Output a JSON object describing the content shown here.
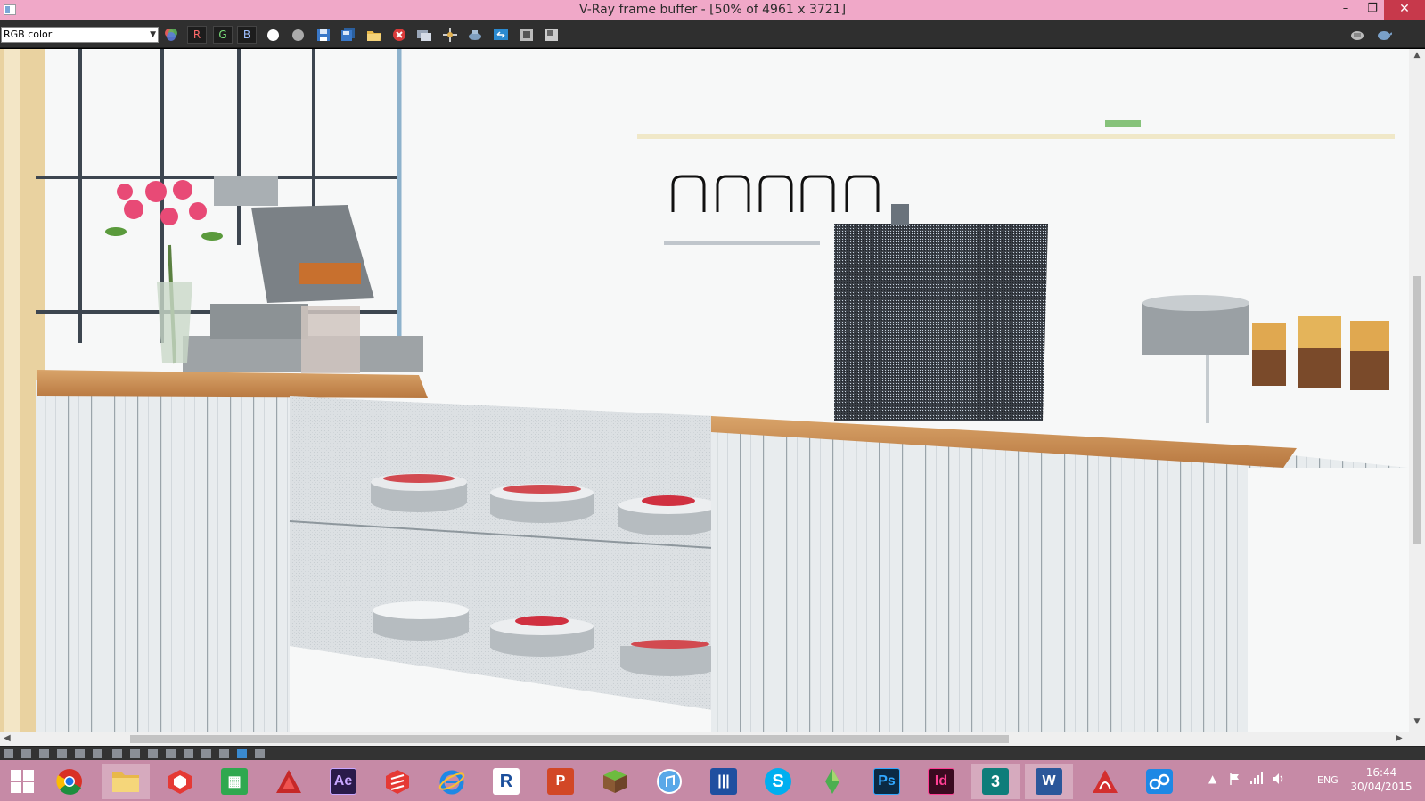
{
  "window": {
    "title": "V-Ray frame buffer - [50% of 4961 x 3721]",
    "minimize_glyph": "–",
    "maximize_glyph": "❐",
    "close_glyph": "✕"
  },
  "toolbar": {
    "channel_select_value": "RGB color",
    "red_channel_label": "R",
    "green_channel_label": "G",
    "blue_channel_label": "B"
  },
  "colors": {
    "titlebar": "#f0a8c8",
    "taskbar": "#c68aa6",
    "close": "#c7394b"
  },
  "taskbar": {
    "apps": [
      {
        "icon": "chrome-icon"
      },
      {
        "icon": "file-explorer-icon"
      },
      {
        "icon": "sketchup-icon"
      },
      {
        "icon": "store-icon"
      },
      {
        "icon": "autocad-icon"
      },
      {
        "icon": "after-effects-icon",
        "text": "Ae"
      },
      {
        "icon": "sketchup-make-icon"
      },
      {
        "icon": "internet-explorer-icon"
      },
      {
        "icon": "revit-icon",
        "text": "R"
      },
      {
        "icon": "powerpoint-icon",
        "text": "P"
      },
      {
        "icon": "minecraft-icon"
      },
      {
        "icon": "itunes-icon"
      },
      {
        "icon": "media-player-icon"
      },
      {
        "icon": "skype-icon",
        "text": "S"
      },
      {
        "icon": "sims-icon"
      },
      {
        "icon": "photoshop-icon",
        "text": "Ps"
      },
      {
        "icon": "indesign-icon",
        "text": "Id"
      },
      {
        "icon": "3ds-max-icon",
        "text": "3"
      },
      {
        "icon": "word-icon",
        "text": "W"
      },
      {
        "icon": "acrobat-icon"
      },
      {
        "icon": "cloud-sync-icon"
      }
    ],
    "language": "ENG",
    "time": "16:44",
    "date": "30/04/2015"
  }
}
